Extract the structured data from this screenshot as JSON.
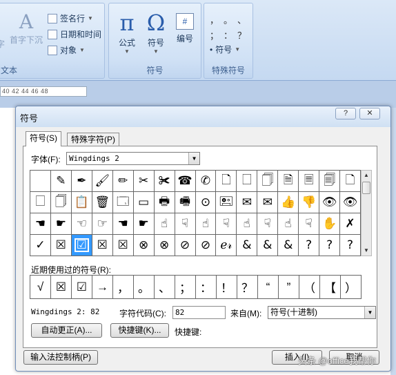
{
  "ribbon": {
    "text_group": {
      "label": "文本",
      "partial_left": "字",
      "drop_cap": "首字下沉",
      "signature_line": "签名行",
      "date_time": "日期和时间",
      "object": "对象"
    },
    "symbols_group": {
      "label": "符号",
      "equation": "公式",
      "symbol": "符号",
      "numbering": "编号",
      "equation_glyph": "π",
      "symbol_glyph": "Ω",
      "numbering_glyph": "#"
    },
    "special_group": {
      "label": "特殊符号",
      "row1": [
        "，",
        "。",
        "、"
      ],
      "row2": [
        "；",
        "：",
        "？"
      ],
      "symbol_button": "符号"
    }
  },
  "ruler": {
    "ticks": "40  42  44  46  48"
  },
  "dialog": {
    "title": "符号",
    "help_button": "?",
    "close_button": "✕",
    "tabs": [
      {
        "label": "符号(S)",
        "active": true
      },
      {
        "label": "特殊字符(P)",
        "active": false
      }
    ],
    "font_label": "字体(F):",
    "font_value": "Wingdings 2",
    "symbol_grid": [
      [
        "",
        "✎",
        "✒",
        "🖌",
        "✏",
        "✂",
        "✀",
        "☎",
        "✆",
        "🗋",
        "🗌",
        "🗍",
        "🗎",
        "🗏",
        "🗐",
        "🗋"
      ],
      [
        "🗌",
        "🗍",
        "📋",
        "🗑",
        "🗔",
        "▭",
        "🖶",
        "🖷",
        "⊙",
        "🖭",
        "✉",
        "✉",
        "👍",
        "👎",
        "👁",
        "👁"
      ],
      [
        "☚",
        "☛",
        "☜",
        "☞",
        "☚",
        "☛",
        "☝",
        "☟",
        "☝",
        "☟",
        "☝",
        "☟",
        "☝",
        "☟",
        "✋",
        "✗"
      ],
      [
        "✓",
        "☒",
        "☑",
        "☒",
        "☒",
        "⊗",
        "⊗",
        "⊘",
        "⊘",
        "ℯ𝓇",
        "&",
        "&",
        "&",
        "?",
        "?",
        "?"
      ]
    ],
    "selected_cell": "☑",
    "recent_label": "近期使用过的符号(R):",
    "recent_symbols": [
      "√",
      "☒",
      "☑",
      "→",
      "，",
      "。",
      "、",
      "；",
      "：",
      "！",
      "？",
      "“",
      "”",
      "（",
      "【",
      "）"
    ],
    "font_status": "Wingdings 2: 82",
    "char_code_label": "字符代码(C):",
    "char_code_value": "82",
    "from_label": "来自(M):",
    "from_value": "符号(十进制)",
    "autocorrect_button": "自动更正(A)...",
    "shortcut_button": "快捷键(K)...",
    "shortcut_label": "快捷键:",
    "ime_button": "输入法控制柄(P)",
    "insert_button": "插入(I)",
    "cancel_button": "取消"
  },
  "watermark": "头条 @office我帮你",
  "colors": {
    "selected": "#3399ff",
    "ribbon": "#dbe8f7",
    "dialog": "#f0f0f0"
  }
}
